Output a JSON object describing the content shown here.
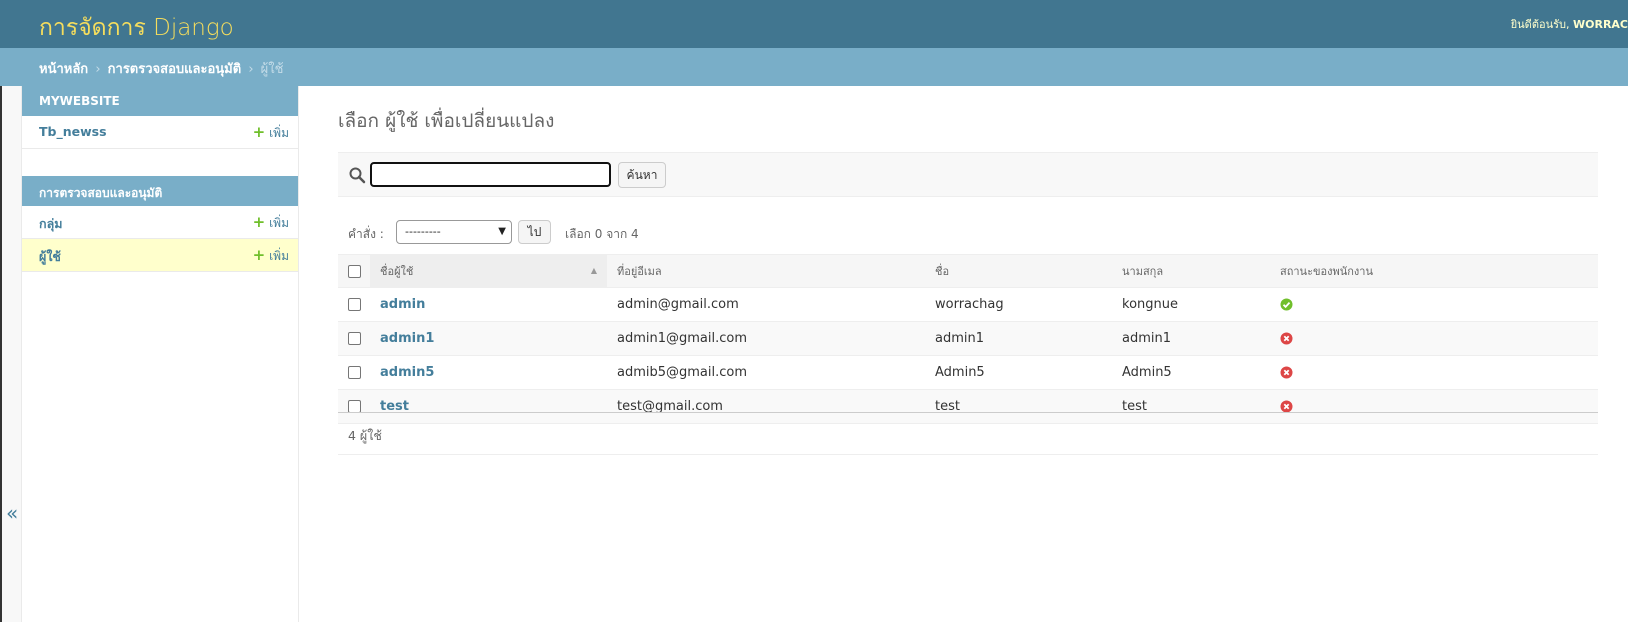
{
  "header": {
    "branding": "การจัดการ Django",
    "welcome": "ยินดีต้อนรับ,",
    "username": "WORRAC"
  },
  "breadcrumbs": {
    "home": "หน้าหลัก",
    "app": "การตรวจสอบและอนุมัติ",
    "current": "ผู้ใช้",
    "separator": "›"
  },
  "nav_toggle": "«",
  "sidebar": {
    "modules": [
      {
        "caption": "MYWEBSITE",
        "items": [
          {
            "label": "Tb_newss",
            "add_label": "เพิ่ม"
          }
        ]
      },
      {
        "caption": "การตรวจสอบและอนุมัติ",
        "items": [
          {
            "label": "กลุ่ม",
            "add_label": "เพิ่ม"
          },
          {
            "label": "ผู้ใช้",
            "add_label": "เพิ่ม"
          }
        ]
      }
    ]
  },
  "content": {
    "title": "เลือก ผู้ใช้ เพื่อเปลี่ยนแปลง"
  },
  "search": {
    "value": "",
    "button_label": "ค้นหา"
  },
  "actions": {
    "label": "คำสั่ง :",
    "selected_option": "---------",
    "go_label": "ไป",
    "counter": "เลือก 0 จาก 4"
  },
  "table": {
    "columns": [
      "ชื่อผู้ใช้",
      "ที่อยู่อีเมล",
      "ชื่อ",
      "นามสกุล",
      "สถานะของพนักงาน"
    ],
    "rows": [
      {
        "username": "admin",
        "email": "admin@gmail.com",
        "first_name": "worrachag",
        "last_name": "kongnue",
        "is_staff": "yes"
      },
      {
        "username": "admin1",
        "email": "admin1@gmail.com",
        "first_name": "admin1",
        "last_name": "admin1",
        "is_staff": "no"
      },
      {
        "username": "admin5",
        "email": "admib5@gmail.com",
        "first_name": "Admin5",
        "last_name": "Admin5",
        "is_staff": "no"
      },
      {
        "username": "test",
        "email": "test@gmail.com",
        "first_name": "test",
        "last_name": "test",
        "is_staff": "no"
      }
    ]
  },
  "paginator": "4 ผู้ใช้",
  "colors": {
    "header_bg": "#417690",
    "breadcrumb_bg": "#79aec8",
    "branding": "#f5dd5d",
    "link": "#447e9b",
    "add_plus": "#70bf2b",
    "status_yes": "#70bf2b",
    "status_no": "#dd4646",
    "current_row": "#ffffcc"
  },
  "icons": {
    "search": "search-icon",
    "add": "plus-icon",
    "status_yes": "check-circle-icon",
    "status_no": "x-circle-icon",
    "sort": "sort-ascending-icon",
    "toggle": "double-chevron-left-icon"
  }
}
